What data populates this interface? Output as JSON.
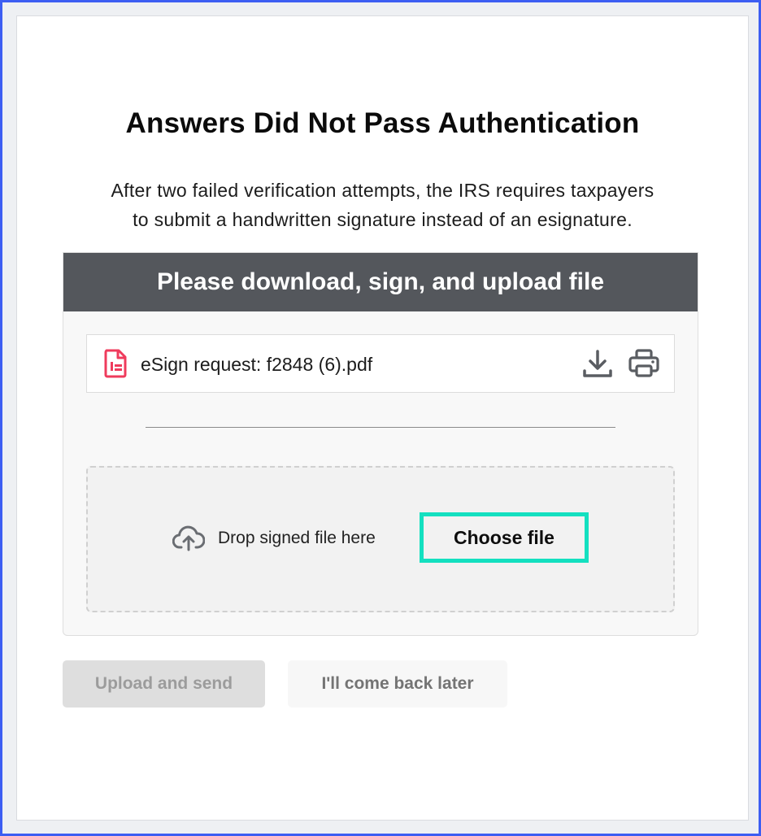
{
  "modal": {
    "title": "Answers Did Not Pass Authentication",
    "subtitle_line1": "After two failed verification attempts, the IRS requires taxpayers",
    "subtitle_line2": "to submit a handwritten signature instead of an esignature."
  },
  "panel": {
    "header": "Please download, sign, and upload file",
    "file": {
      "name": "eSign request: f2848 (6).pdf",
      "icon": "pdf-file-icon",
      "actions": [
        "download-icon",
        "print-icon"
      ]
    },
    "dropzone": {
      "text": "Drop signed file here",
      "icon": "cloud-upload-icon",
      "choose_label": "Choose file"
    }
  },
  "actions": {
    "upload_label": "Upload and send",
    "later_label": "I'll come back later"
  },
  "colors": {
    "frame_border": "#3d5ef2",
    "header_bg": "#54575c",
    "pdf_icon": "#ef3b5c",
    "choose_outline": "#14e0c0",
    "upload_disabled_bg": "#dedede"
  }
}
